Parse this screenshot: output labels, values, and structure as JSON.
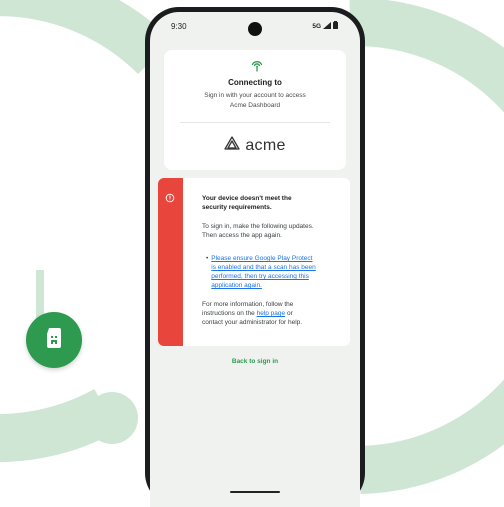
{
  "colors": {
    "ring": "#cfe6d5",
    "accent_green": "#2e9a4f",
    "error_red": "#e8453c",
    "link_blue": "#1a73e8"
  },
  "status_bar": {
    "time": "9:30",
    "network": "5G"
  },
  "connect_card": {
    "icon": "wifi-broadcast-icon",
    "title": "Connecting to",
    "subtitle_line1": "Sign in with your account to access",
    "subtitle_line2": "Acme Dashboard",
    "logo_text": "acme"
  },
  "error_card": {
    "icon": "error-icon",
    "title_line1": "Your device doesn't meet the",
    "title_line2": "security requirements.",
    "body_line1": "To sign in, make the following updates.",
    "body_line2": "Then access the app again.",
    "bullet_line1": "Please ensure Google Play Protect",
    "bullet_line2": "is enabled and that a scan has been",
    "bullet_line3": "performed, then try accessing this",
    "bullet_line4": "application again.",
    "more_line1": "For more information, follow the",
    "more_prefix": "instructions on the",
    "help_link": "help page",
    "more_suffix": "or",
    "more_line3": "contact your administrator for help."
  },
  "back_link": "Back to sign in",
  "badge_icon": "sim-card-icon"
}
